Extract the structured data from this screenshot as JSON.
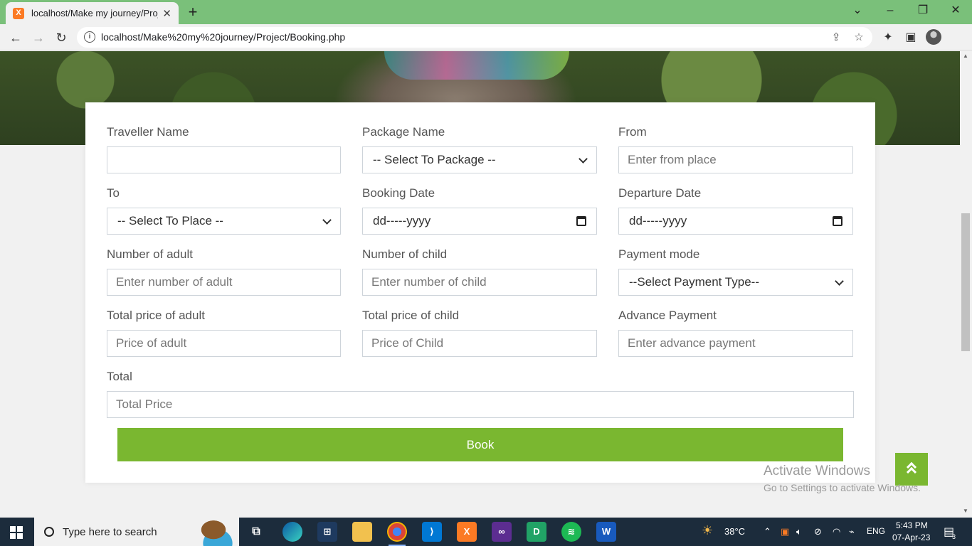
{
  "browser": {
    "tab_title": "localhost/Make my journey/Proje",
    "tab_favicon_letter": "X",
    "url": "localhost/Make%20my%20journey/Project/Booking.php"
  },
  "form": {
    "traveller_name": {
      "label": "Traveller Name",
      "value": "",
      "placeholder": ""
    },
    "package_name": {
      "label": "Package Name",
      "selected": "-- Select To Package --"
    },
    "from": {
      "label": "From",
      "placeholder": "Enter from place"
    },
    "to": {
      "label": "To",
      "selected": "-- Select To Place --"
    },
    "booking_date": {
      "label": "Booking Date",
      "value": "dd-----yyyy"
    },
    "departure_date": {
      "label": "Departure Date",
      "value": "dd-----yyyy"
    },
    "num_adult": {
      "label": "Number of adult",
      "placeholder": "Enter number of adult"
    },
    "num_child": {
      "label": "Number of child",
      "placeholder": "Enter number of child"
    },
    "payment_mode": {
      "label": "Payment mode",
      "selected": "--Select Payment Type--"
    },
    "price_adult": {
      "label": "Total price of adult",
      "placeholder": "Price of adult"
    },
    "price_child": {
      "label": "Total price of child",
      "placeholder": "Price of Child"
    },
    "advance_payment": {
      "label": "Advance Payment",
      "placeholder": "Enter advance payment"
    },
    "total": {
      "label": "Total",
      "placeholder": "Total Price"
    },
    "book_label": "Book"
  },
  "watermark": {
    "line1": "Activate Windows",
    "line2": "Go to Settings to activate Windows."
  },
  "taskbar": {
    "search_text": "Type here to search",
    "weather": "38°C",
    "language": "ENG",
    "time": "5:43 PM",
    "date": "07-Apr-23",
    "notification_count": "3"
  },
  "colors": {
    "accent_green": "#7ab730",
    "chrome_green": "#7ac07a",
    "taskbar": "#1c2c3c"
  }
}
